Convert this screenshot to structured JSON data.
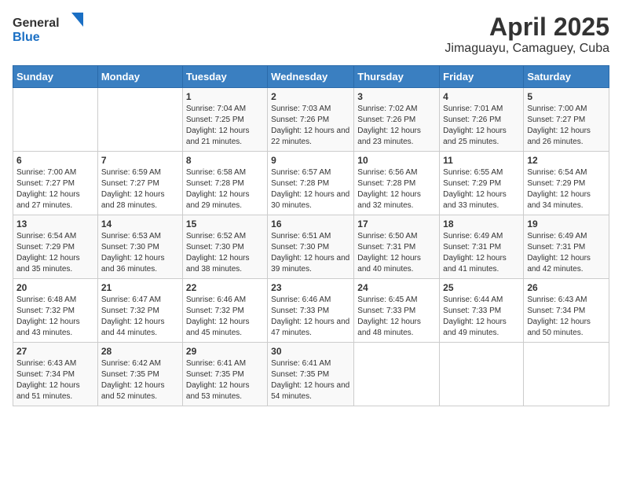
{
  "header": {
    "logo_general": "General",
    "logo_blue": "Blue",
    "title": "April 2025",
    "subtitle": "Jimaguayu, Camaguey, Cuba"
  },
  "days_of_week": [
    "Sunday",
    "Monday",
    "Tuesday",
    "Wednesday",
    "Thursday",
    "Friday",
    "Saturday"
  ],
  "weeks": [
    [
      {
        "day": "",
        "sunrise": "",
        "sunset": "",
        "daylight": ""
      },
      {
        "day": "",
        "sunrise": "",
        "sunset": "",
        "daylight": ""
      },
      {
        "day": "1",
        "sunrise": "Sunrise: 7:04 AM",
        "sunset": "Sunset: 7:25 PM",
        "daylight": "Daylight: 12 hours and 21 minutes."
      },
      {
        "day": "2",
        "sunrise": "Sunrise: 7:03 AM",
        "sunset": "Sunset: 7:26 PM",
        "daylight": "Daylight: 12 hours and 22 minutes."
      },
      {
        "day": "3",
        "sunrise": "Sunrise: 7:02 AM",
        "sunset": "Sunset: 7:26 PM",
        "daylight": "Daylight: 12 hours and 23 minutes."
      },
      {
        "day": "4",
        "sunrise": "Sunrise: 7:01 AM",
        "sunset": "Sunset: 7:26 PM",
        "daylight": "Daylight: 12 hours and 25 minutes."
      },
      {
        "day": "5",
        "sunrise": "Sunrise: 7:00 AM",
        "sunset": "Sunset: 7:27 PM",
        "daylight": "Daylight: 12 hours and 26 minutes."
      }
    ],
    [
      {
        "day": "6",
        "sunrise": "Sunrise: 7:00 AM",
        "sunset": "Sunset: 7:27 PM",
        "daylight": "Daylight: 12 hours and 27 minutes."
      },
      {
        "day": "7",
        "sunrise": "Sunrise: 6:59 AM",
        "sunset": "Sunset: 7:27 PM",
        "daylight": "Daylight: 12 hours and 28 minutes."
      },
      {
        "day": "8",
        "sunrise": "Sunrise: 6:58 AM",
        "sunset": "Sunset: 7:28 PM",
        "daylight": "Daylight: 12 hours and 29 minutes."
      },
      {
        "day": "9",
        "sunrise": "Sunrise: 6:57 AM",
        "sunset": "Sunset: 7:28 PM",
        "daylight": "Daylight: 12 hours and 30 minutes."
      },
      {
        "day": "10",
        "sunrise": "Sunrise: 6:56 AM",
        "sunset": "Sunset: 7:28 PM",
        "daylight": "Daylight: 12 hours and 32 minutes."
      },
      {
        "day": "11",
        "sunrise": "Sunrise: 6:55 AM",
        "sunset": "Sunset: 7:29 PM",
        "daylight": "Daylight: 12 hours and 33 minutes."
      },
      {
        "day": "12",
        "sunrise": "Sunrise: 6:54 AM",
        "sunset": "Sunset: 7:29 PM",
        "daylight": "Daylight: 12 hours and 34 minutes."
      }
    ],
    [
      {
        "day": "13",
        "sunrise": "Sunrise: 6:54 AM",
        "sunset": "Sunset: 7:29 PM",
        "daylight": "Daylight: 12 hours and 35 minutes."
      },
      {
        "day": "14",
        "sunrise": "Sunrise: 6:53 AM",
        "sunset": "Sunset: 7:30 PM",
        "daylight": "Daylight: 12 hours and 36 minutes."
      },
      {
        "day": "15",
        "sunrise": "Sunrise: 6:52 AM",
        "sunset": "Sunset: 7:30 PM",
        "daylight": "Daylight: 12 hours and 38 minutes."
      },
      {
        "day": "16",
        "sunrise": "Sunrise: 6:51 AM",
        "sunset": "Sunset: 7:30 PM",
        "daylight": "Daylight: 12 hours and 39 minutes."
      },
      {
        "day": "17",
        "sunrise": "Sunrise: 6:50 AM",
        "sunset": "Sunset: 7:31 PM",
        "daylight": "Daylight: 12 hours and 40 minutes."
      },
      {
        "day": "18",
        "sunrise": "Sunrise: 6:49 AM",
        "sunset": "Sunset: 7:31 PM",
        "daylight": "Daylight: 12 hours and 41 minutes."
      },
      {
        "day": "19",
        "sunrise": "Sunrise: 6:49 AM",
        "sunset": "Sunset: 7:31 PM",
        "daylight": "Daylight: 12 hours and 42 minutes."
      }
    ],
    [
      {
        "day": "20",
        "sunrise": "Sunrise: 6:48 AM",
        "sunset": "Sunset: 7:32 PM",
        "daylight": "Daylight: 12 hours and 43 minutes."
      },
      {
        "day": "21",
        "sunrise": "Sunrise: 6:47 AM",
        "sunset": "Sunset: 7:32 PM",
        "daylight": "Daylight: 12 hours and 44 minutes."
      },
      {
        "day": "22",
        "sunrise": "Sunrise: 6:46 AM",
        "sunset": "Sunset: 7:32 PM",
        "daylight": "Daylight: 12 hours and 45 minutes."
      },
      {
        "day": "23",
        "sunrise": "Sunrise: 6:46 AM",
        "sunset": "Sunset: 7:33 PM",
        "daylight": "Daylight: 12 hours and 47 minutes."
      },
      {
        "day": "24",
        "sunrise": "Sunrise: 6:45 AM",
        "sunset": "Sunset: 7:33 PM",
        "daylight": "Daylight: 12 hours and 48 minutes."
      },
      {
        "day": "25",
        "sunrise": "Sunrise: 6:44 AM",
        "sunset": "Sunset: 7:33 PM",
        "daylight": "Daylight: 12 hours and 49 minutes."
      },
      {
        "day": "26",
        "sunrise": "Sunrise: 6:43 AM",
        "sunset": "Sunset: 7:34 PM",
        "daylight": "Daylight: 12 hours and 50 minutes."
      }
    ],
    [
      {
        "day": "27",
        "sunrise": "Sunrise: 6:43 AM",
        "sunset": "Sunset: 7:34 PM",
        "daylight": "Daylight: 12 hours and 51 minutes."
      },
      {
        "day": "28",
        "sunrise": "Sunrise: 6:42 AM",
        "sunset": "Sunset: 7:35 PM",
        "daylight": "Daylight: 12 hours and 52 minutes."
      },
      {
        "day": "29",
        "sunrise": "Sunrise: 6:41 AM",
        "sunset": "Sunset: 7:35 PM",
        "daylight": "Daylight: 12 hours and 53 minutes."
      },
      {
        "day": "30",
        "sunrise": "Sunrise: 6:41 AM",
        "sunset": "Sunset: 7:35 PM",
        "daylight": "Daylight: 12 hours and 54 minutes."
      },
      {
        "day": "",
        "sunrise": "",
        "sunset": "",
        "daylight": ""
      },
      {
        "day": "",
        "sunrise": "",
        "sunset": "",
        "daylight": ""
      },
      {
        "day": "",
        "sunrise": "",
        "sunset": "",
        "daylight": ""
      }
    ]
  ]
}
